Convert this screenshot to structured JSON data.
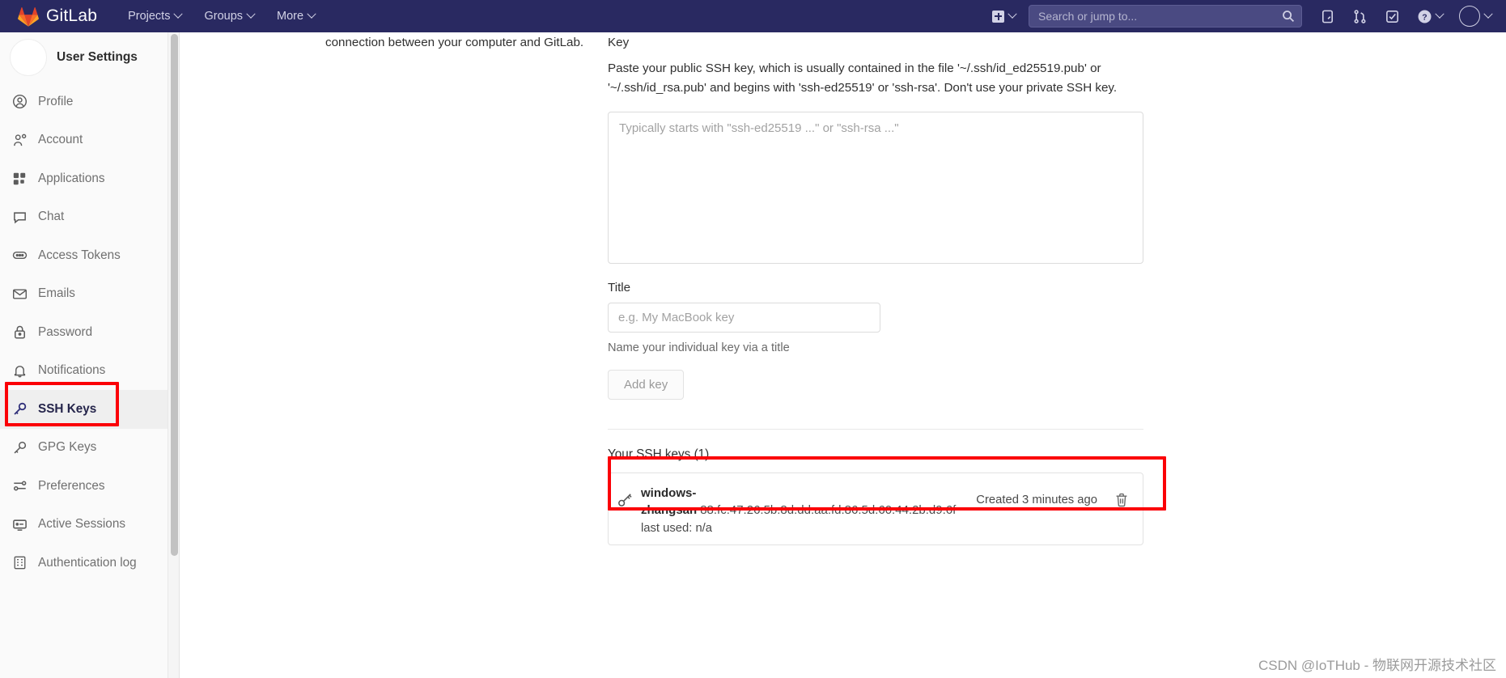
{
  "navbar": {
    "brand": "GitLab",
    "links": [
      {
        "label": "Projects",
        "icon": "chevron-down-icon"
      },
      {
        "label": "Groups",
        "icon": "chevron-down-icon"
      },
      {
        "label": "More",
        "icon": "chevron-down-icon"
      }
    ],
    "create_new": {
      "icon": "plus-square-icon",
      "caret": "chevron-down-icon"
    },
    "search": {
      "placeholder": "Search or jump to...",
      "value": "",
      "icon": "search-icon"
    },
    "icons": [
      {
        "name": "issues-icon"
      },
      {
        "name": "merge-requests-icon"
      },
      {
        "name": "todos-icon"
      },
      {
        "name": "help-icon"
      }
    ],
    "avatar": {
      "name": "user-avatar",
      "caret": "chevron-down-icon"
    },
    "background_color": "#292961"
  },
  "sidebar": {
    "title": "User Settings",
    "active_item": "SSH Keys",
    "items": [
      {
        "label": "Profile",
        "icon": "profile-icon"
      },
      {
        "label": "Account",
        "icon": "account-icon"
      },
      {
        "label": "Applications",
        "icon": "applications-icon"
      },
      {
        "label": "Chat",
        "icon": "chat-icon"
      },
      {
        "label": "Access Tokens",
        "icon": "access-tokens-icon"
      },
      {
        "label": "Emails",
        "icon": "email-icon"
      },
      {
        "label": "Password",
        "icon": "lock-icon"
      },
      {
        "label": "Notifications",
        "icon": "bell-icon"
      },
      {
        "label": "SSH Keys",
        "icon": "key-icon"
      },
      {
        "label": "GPG Keys",
        "icon": "key-icon"
      },
      {
        "label": "Preferences",
        "icon": "sliders-icon"
      },
      {
        "label": "Active Sessions",
        "icon": "monitor-icon"
      },
      {
        "label": "Authentication log",
        "icon": "log-icon"
      }
    ]
  },
  "main": {
    "intro_text": "connection between your computer and GitLab.",
    "key_field": {
      "label": "Key",
      "description": "Paste your public SSH key, which is usually contained in the file '~/.ssh/id_ed25519.pub' or '~/.ssh/id_rsa.pub' and begins with 'ssh-ed25519' or 'ssh-rsa'. Don't use your private SSH key.",
      "placeholder": "Typically starts with \"ssh-ed25519 ...\" or \"ssh-rsa ...\"",
      "value": ""
    },
    "title_field": {
      "label": "Title",
      "placeholder": "e.g. My MacBook key",
      "value": "",
      "hint": "Name your individual key via a title"
    },
    "add_key_button": "Add key",
    "keys_section": {
      "heading": "Your SSH keys (1)",
      "rows": [
        {
          "icon": "key-icon",
          "title": "windows-zhangsan",
          "fingerprint": "88:fc:47:26:5b:8d:dd:aa:fd:86:5d:60:44:2b:d9:6f",
          "last_used": "last used: n/a",
          "created": "Created 3 minutes ago",
          "delete_icon": "trash-icon"
        }
      ]
    }
  },
  "annotations": {
    "highlight_color": "#fb0007",
    "boxes": [
      {
        "name": "ssh-keys-sidebar-highlight"
      },
      {
        "name": "ssh-key-row-highlight"
      }
    ]
  },
  "watermark": "CSDN @IoTHub - 物联网开源技术社区"
}
